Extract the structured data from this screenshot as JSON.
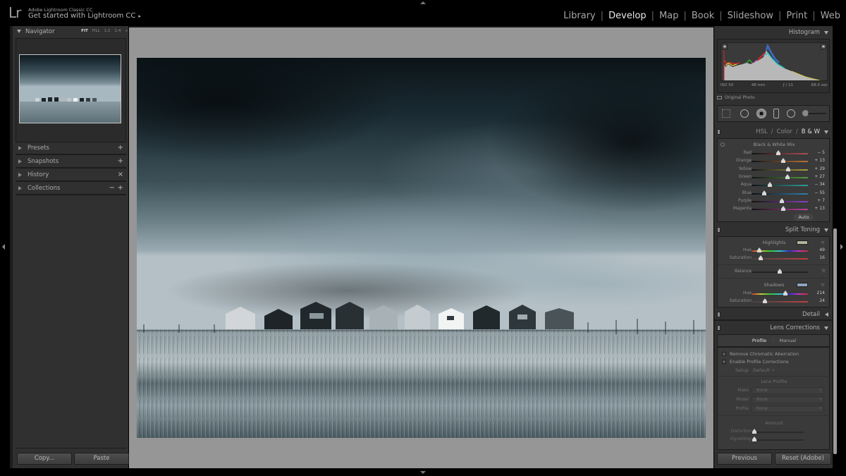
{
  "app": {
    "logo": "Lr",
    "product_name": "Adobe Lightroom Classic CC",
    "get_started": "Get started with Lightroom CC",
    "get_started_arrow": "▸"
  },
  "modules": [
    {
      "label": "Library",
      "active": false
    },
    {
      "label": "Develop",
      "active": true
    },
    {
      "label": "Map",
      "active": false
    },
    {
      "label": "Book",
      "active": false
    },
    {
      "label": "Slideshow",
      "active": false
    },
    {
      "label": "Print",
      "active": false
    },
    {
      "label": "Web",
      "active": false
    }
  ],
  "left_panel": {
    "navigator": {
      "title": "Navigator",
      "zoom_options": [
        "FIT",
        "FILL",
        "1:1",
        "1:4"
      ],
      "zoom_active": "FIT",
      "zoom_stepper": "÷"
    },
    "sections": [
      {
        "label": "Presets",
        "action": "+"
      },
      {
        "label": "Snapshots",
        "action": "+"
      },
      {
        "label": "History",
        "action": "×"
      },
      {
        "label": "Collections",
        "action_minus": "−",
        "action": "+"
      }
    ],
    "copy_label": "Copy...",
    "paste_label": "Paste"
  },
  "right_panel": {
    "histogram": {
      "title": "Histogram",
      "iso": "ISO 50",
      "focal_length": "48 mm",
      "aperture": "ƒ / 11",
      "shutter": "68.0 sec",
      "original_photo": "Original Photo"
    },
    "hsl": {
      "tab_hsl": "HSL",
      "tab_color": "Color",
      "tab_bw": "B & W",
      "separator": "/",
      "section_title": "Black & White Mix",
      "sliders": [
        {
          "label": "Red",
          "value": "− 5",
          "num": -5,
          "color": "#b05050"
        },
        {
          "label": "Orange",
          "value": "+ 13",
          "num": 13,
          "color": "#c07030"
        },
        {
          "label": "Yellow",
          "value": "+ 29",
          "num": 29,
          "color": "#b0a040"
        },
        {
          "label": "Green",
          "value": "+ 27",
          "num": 27,
          "color": "#50a040"
        },
        {
          "label": "Aqua",
          "value": "− 34",
          "num": -34,
          "color": "#30a0a0"
        },
        {
          "label": "Blue",
          "value": "− 55",
          "num": -55,
          "color": "#3080b0"
        },
        {
          "label": "Purple",
          "value": "+ 7",
          "num": 7,
          "color": "#9040c0"
        },
        {
          "label": "Magenta",
          "value": "+ 13",
          "num": 13,
          "color": "#c040a0"
        }
      ],
      "auto_label": "Auto"
    },
    "split_toning": {
      "title": "Split Toning",
      "highlights_label": "Highlights",
      "highlights_swatch": "#b3b39e",
      "highlights_hue_label": "Hue",
      "highlights_hue": "49",
      "highlights_hue_num": 49,
      "highlights_sat_label": "Saturation",
      "highlights_sat": "16",
      "highlights_sat_num": 16,
      "balance_label": "Balance",
      "balance": "0",
      "balance_num": 0,
      "shadows_label": "Shadows",
      "shadows_swatch": "#8ea4c0",
      "shadows_hue_label": "Hue",
      "shadows_hue": "214",
      "shadows_hue_num": 214,
      "shadows_sat_label": "Saturation",
      "shadows_sat": "24",
      "shadows_sat_num": 24
    },
    "detail": {
      "title": "Detail"
    },
    "lens_corrections": {
      "title": "Lens Corrections",
      "tab_profile": "Profile",
      "tab_manual": "Manual",
      "remove_ca": "Remove Chromatic Aberration",
      "enable_profile": "Enable Profile Corrections",
      "setup_label": "Setup",
      "setup_value": "Default ÷",
      "lens_profile_title": "Lens Profile",
      "make_label": "Make",
      "make_value": "None",
      "model_label": "Model",
      "model_value": "None",
      "profile_label": "Profile",
      "profile_value": "None",
      "amount_title": "Amount",
      "distortion_label": "Distortion",
      "vignetting_label": "Vignetting"
    },
    "previous_label": "Previous",
    "reset_label": "Reset (Adobe)"
  }
}
